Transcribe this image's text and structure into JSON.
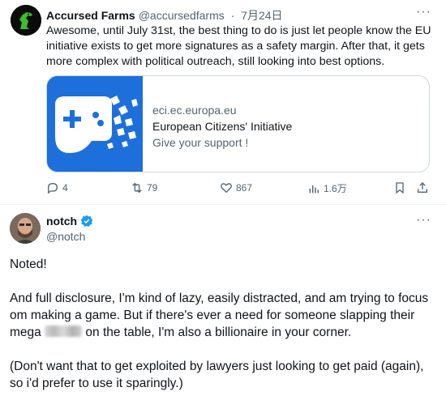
{
  "tweet1": {
    "display_name": "Accursed Farms",
    "handle": "@accursedfarms",
    "separator": "·",
    "date": "7月24日",
    "more": "···",
    "text": "Awesome, until July 31st, the best thing to do is just let people know the EU initiative exists to get more signatures as a safety margin.  After that, it gets more complex with political outreach, still looking into best options.",
    "card": {
      "domain": "eci.ec.europa.eu",
      "title": "European Citizens' Initiative",
      "description": "Give your support !"
    },
    "actions": {
      "replies": "4",
      "reposts": "79",
      "likes": "867",
      "views": "1.6万"
    }
  },
  "tweet2": {
    "display_name": "notch",
    "handle": "@notch",
    "more": "···",
    "paragraphs": {
      "p1": "Noted!",
      "p2a": "And full disclosure, I'm kind of lazy, easily distracted, and am trying to focus om making a game. But if there's ever a need for someone slapping their mega ",
      "p2b": " on the table, I'm also a billionaire in your corner.",
      "p3": "(Don't want that to get exploited by lawyers just looking to get paid (again), so i'd prefer to use it sparingly.)"
    }
  },
  "colors": {
    "text": "#0f1419",
    "secondary": "#536471",
    "verified": "#1d9bf0",
    "card_image": "#1d6fdc"
  }
}
